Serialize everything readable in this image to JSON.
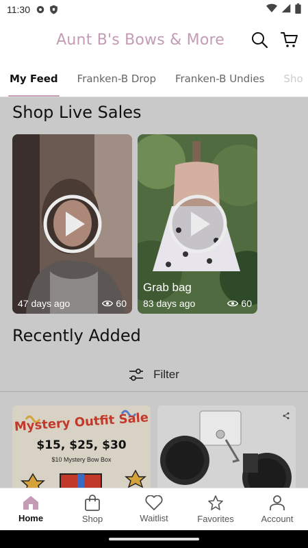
{
  "status_bar": {
    "time": "11:30"
  },
  "header": {
    "title": "Aunt B's Bows & More"
  },
  "tabs": [
    {
      "label": "My Feed"
    },
    {
      "label": "Franken-B Drop"
    },
    {
      "label": "Franken-B Undies"
    },
    {
      "label": "Sho"
    }
  ],
  "live_sales": {
    "title": "Shop Live Sales",
    "videos": [
      {
        "label": "",
        "age": "47 days ago",
        "views": "60"
      },
      {
        "label": "Grab bag",
        "age": "83 days ago",
        "views": "60"
      }
    ]
  },
  "recently_added": {
    "title": "Recently Added",
    "filter_label": "Filter",
    "products": [
      {
        "title_line": "Mystery Outfit Sale",
        "prices": "$15, $25, $30",
        "subtitle": "$10 Mystery Bow Box"
      },
      {
        "title_line": ""
      }
    ]
  },
  "bottom_nav": [
    {
      "label": "Home",
      "icon": "home-icon"
    },
    {
      "label": "Shop",
      "icon": "shopping-bag-icon"
    },
    {
      "label": "Waitlist",
      "icon": "heart-icon"
    },
    {
      "label": "Favorites",
      "icon": "star-icon"
    },
    {
      "label": "Account",
      "icon": "person-icon"
    }
  ],
  "colors": {
    "brand": "#c49bb5",
    "overlay": "#c9c9c9"
  }
}
